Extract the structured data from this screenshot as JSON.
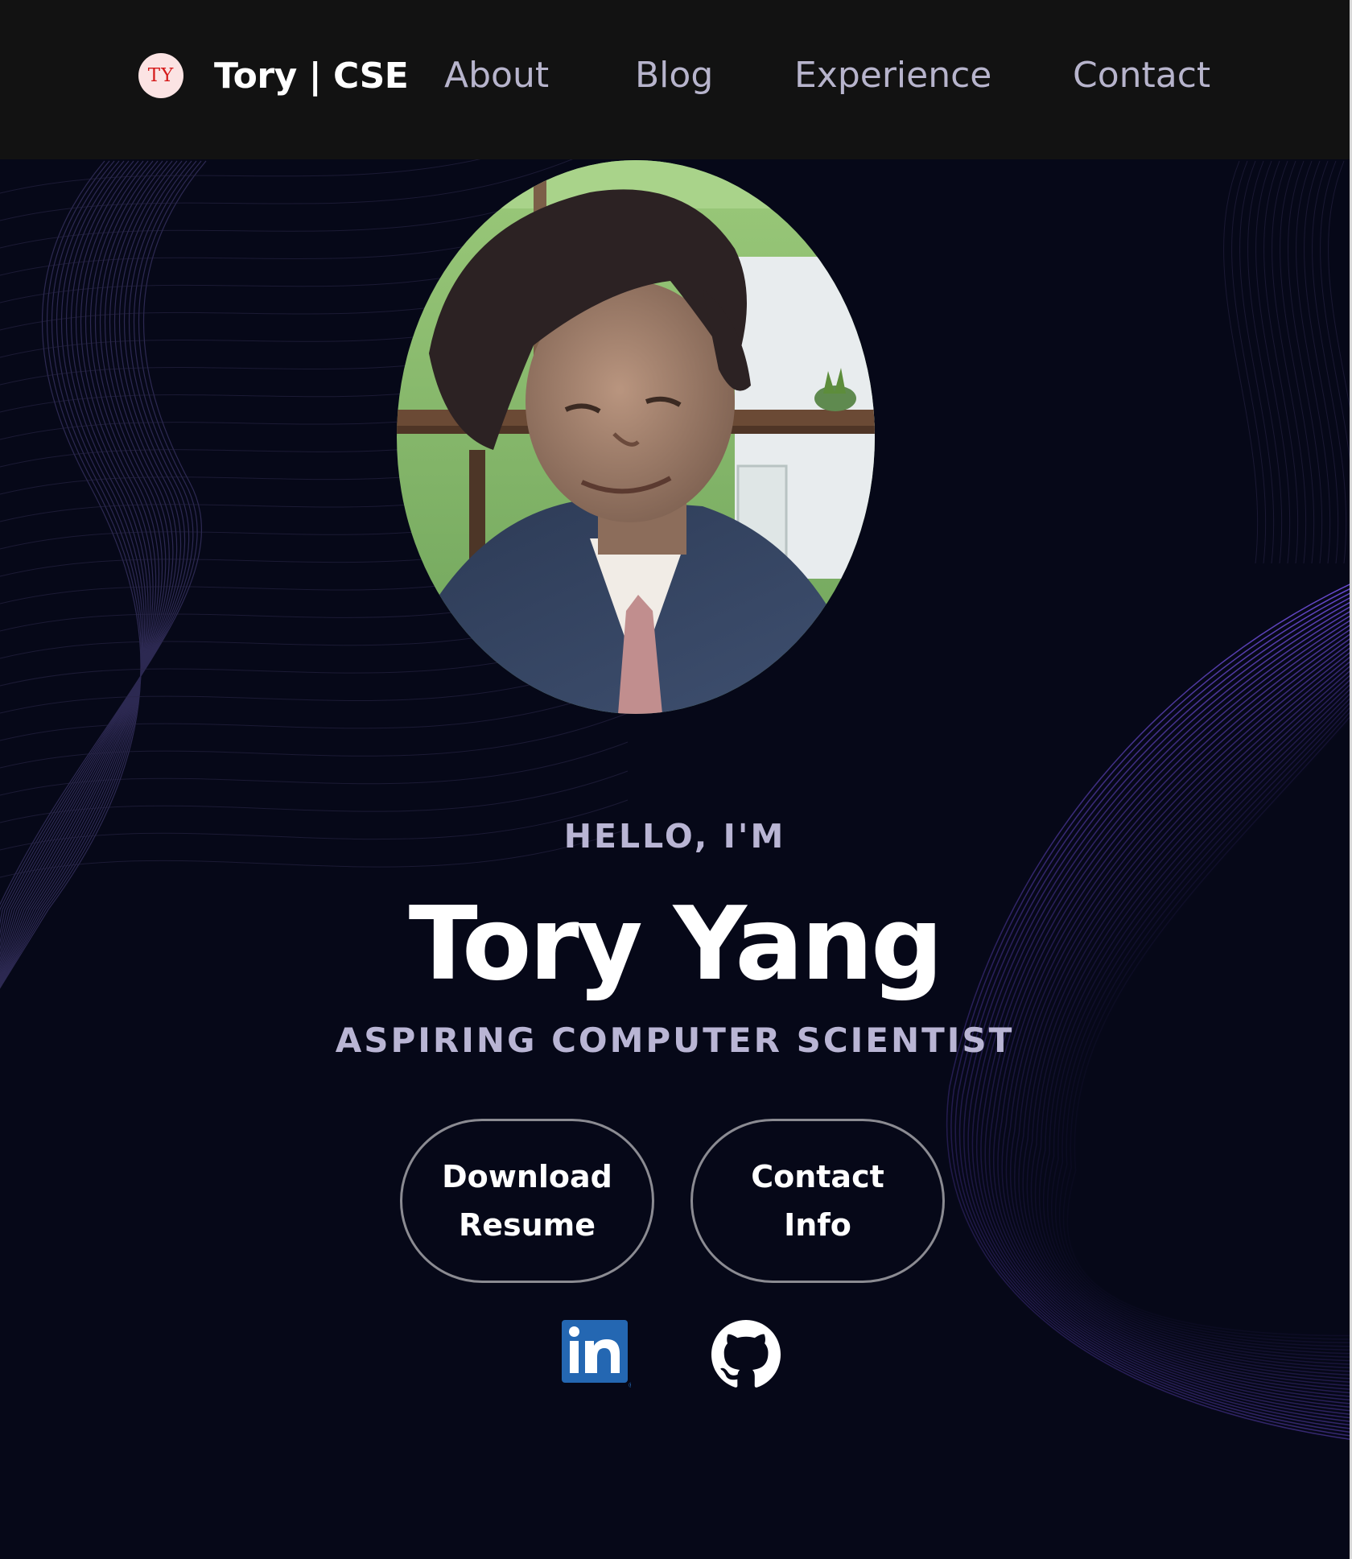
{
  "header": {
    "logo_text": "TY",
    "brand": "Tory | CSE",
    "nav": [
      "About",
      "Blog",
      "Experience",
      "Contact"
    ]
  },
  "hero": {
    "greeting": "HELLO, I'M",
    "name": "Tory Yang",
    "title": "ASPIRING COMPUTER SCIENTIST",
    "buttons": {
      "resume": "Download Resume",
      "contact": "Contact Info"
    }
  },
  "social": {
    "linkedin_icon": "linkedin-icon",
    "github_icon": "github-icon"
  },
  "colors": {
    "header_bg": "#121212",
    "page_bg": "#060818",
    "nav_text": "#b7b4cc",
    "accent_wave": "#6a4fd1",
    "linkedin_blue": "#2467b2"
  }
}
